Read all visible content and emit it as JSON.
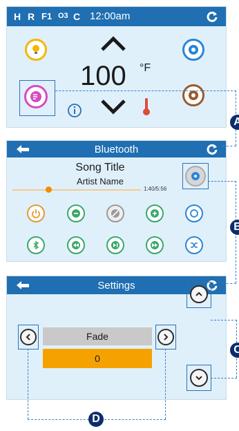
{
  "home": {
    "status_letters": [
      "H",
      "R",
      "F1",
      "O3",
      "C"
    ],
    "time": "12:00am",
    "temperature": "100",
    "unit": "°F"
  },
  "bluetooth": {
    "title": "Bluetooth",
    "song_title": "Song Title",
    "artist_name": "Artist Name",
    "time_progress": "1:40/5:56",
    "progress": 0.28,
    "row1_buttons": [
      "power-icon",
      "volume-down-icon",
      "mute-icon",
      "volume-up-icon",
      "repeat-icon"
    ],
    "row2_buttons": [
      "bluetooth-icon",
      "rewind-icon",
      "play-pause-icon",
      "fast-forward-icon",
      "shuffle-icon"
    ]
  },
  "settings": {
    "title": "Settings",
    "option_label": "Fade",
    "option_value": "0"
  },
  "callouts": {
    "a": "A",
    "b": "B",
    "c": "C",
    "d": "D"
  },
  "colors": {
    "topbar": "#1f6fb2",
    "screen_bg": "#dff0fb",
    "callout": "#0d2d6b",
    "highlight_value": "#f5a200",
    "music_button": "#d64bc2",
    "light_button": "#f3b800",
    "jets_button": "#2a85d8",
    "settings_button": "#9b5a2c"
  }
}
